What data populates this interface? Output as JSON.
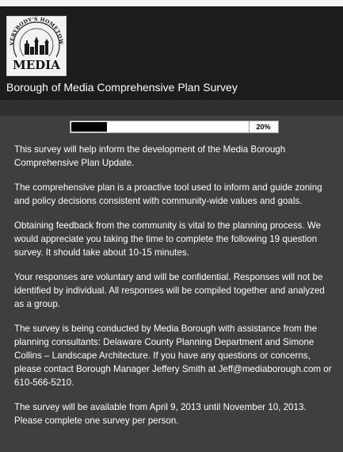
{
  "header": {
    "logo_top_text": "EVERYBODY'S HOMETOWN",
    "logo_bottom_text": "MEDIA",
    "title": "Borough of Media Comprehensive Plan Survey"
  },
  "progress": {
    "percent": 20,
    "label": "20%"
  },
  "intro": {
    "paragraphs": [
      "This survey will help inform the development of the Media Borough Comprehensive Plan Update.",
      "The comprehensive plan is a proactive tool used to inform and guide zoning and policy decisions consistent with community-wide values and goals.",
      "Obtaining feedback from the community is vital to the planning process. We would appreciate you taking the time to complete the following 19 question survey. It should take about 10-15 minutes.",
      "Your responses are voluntary and will be confidential. Responses will not be identified by individual. All responses will be compiled together and analyzed as a group.",
      "The survey is being conducted by Media Borough with assistance from the planning consultants: Delaware County Planning Department and Simone Collins – Landscape Architecture. If you have any questions or concerns, please contact Borough Manager Jeffery Smith at Jeff@mediaborough.com or 610-566-5210.",
      "The survey will be available from April 9, 2013 until November 10, 2013. Please complete one survey per person."
    ]
  },
  "colors": {
    "page_background": "#3f3f3f",
    "header_background": "#1d1d1d",
    "strip_background": "#303030",
    "text": "#ffffff",
    "progress_fill": "#000000"
  }
}
